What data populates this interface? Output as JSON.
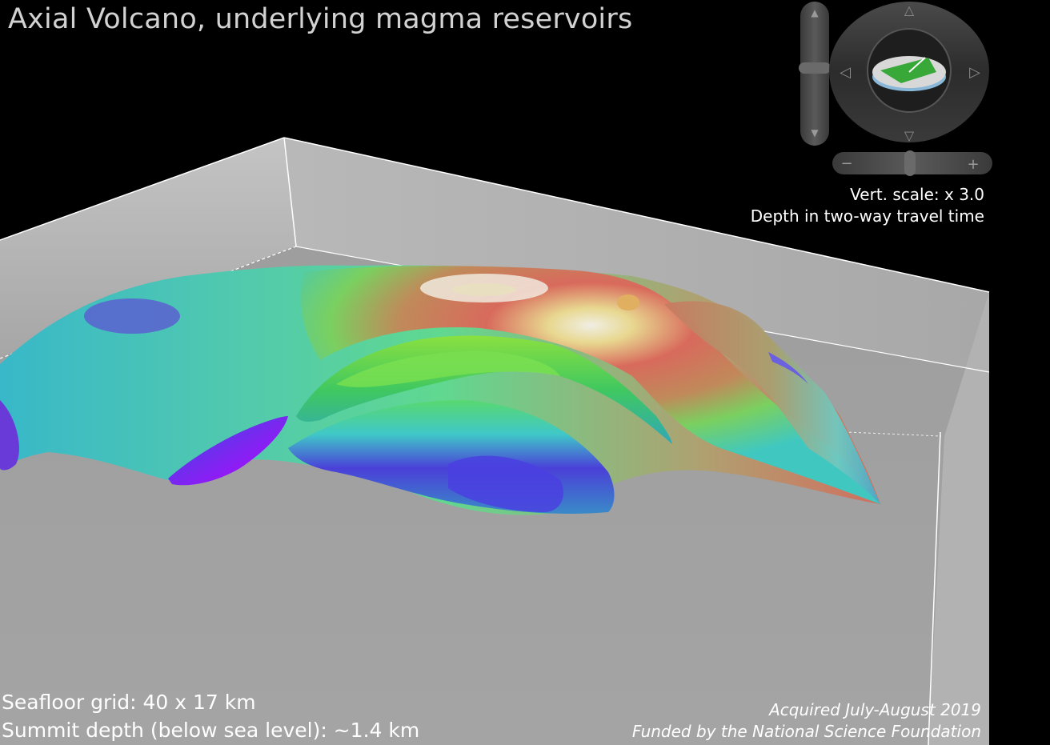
{
  "title": "Axial Volcano, underlying magma reservoirs",
  "vertical_scale": "Vert. scale: x 3.0",
  "depth_mode": "Depth in two-way travel time",
  "seafloor_grid": "Seafloor grid: 40 x 17 km",
  "summit_depth": "Summit depth (below sea level): ~1.4 km",
  "acquired": "Acquired July-August 2019",
  "funded_by": "Funded by the National Science Foundation",
  "nav": {
    "zoom_minus": "−",
    "zoom_plus": "+"
  },
  "colors": {
    "background": "#000000",
    "box_wall": "#a9a9a9",
    "box_floor": "#9a9a9a",
    "ramp": [
      "#b000ff",
      "#4a3ce0",
      "#36c8c8",
      "#3ee070",
      "#c8c060",
      "#e06060",
      "#f2f0e6"
    ]
  }
}
